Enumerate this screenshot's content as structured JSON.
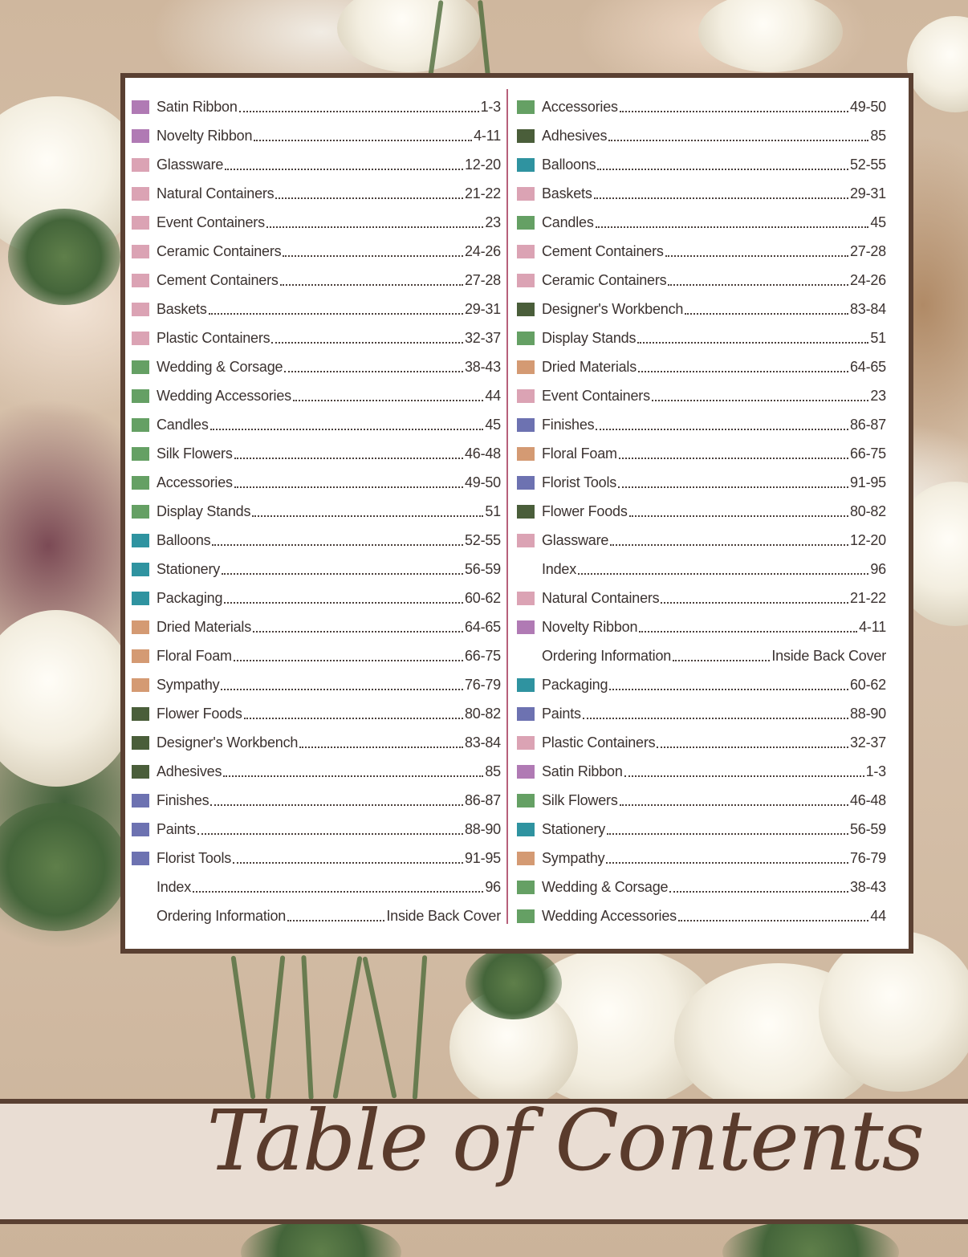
{
  "title": "Table of Contents",
  "colors": {
    "purple": "#b07ab4",
    "pink": "#dba3b4",
    "green": "#65a064",
    "darkgreen": "#4a5e3a",
    "teal": "#2f93a0",
    "tan": "#d49a73",
    "blue": "#6d72b1",
    "frame": "#5a4032",
    "divider": "#b7607a"
  },
  "left_column": [
    {
      "label": "Satin Ribbon",
      "pages": "1-3",
      "color": "purple"
    },
    {
      "label": "Novelty Ribbon",
      "pages": "4-11",
      "color": "purple"
    },
    {
      "label": "Glassware",
      "pages": "12-20",
      "color": "pink"
    },
    {
      "label": "Natural Containers",
      "pages": "21-22",
      "color": "pink"
    },
    {
      "label": "Event Containers",
      "pages": "23",
      "color": "pink"
    },
    {
      "label": "Ceramic Containers",
      "pages": "24-26",
      "color": "pink"
    },
    {
      "label": "Cement Containers",
      "pages": "27-28",
      "color": "pink"
    },
    {
      "label": "Baskets",
      "pages": "29-31",
      "color": "pink"
    },
    {
      "label": "Plastic Containers",
      "pages": "32-37",
      "color": "pink"
    },
    {
      "label": "Wedding & Corsage",
      "pages": "38-43",
      "color": "green"
    },
    {
      "label": "Wedding Accessories",
      "pages": "44",
      "color": "green"
    },
    {
      "label": "Candles",
      "pages": "45",
      "color": "green"
    },
    {
      "label": "Silk Flowers",
      "pages": "46-48",
      "color": "green"
    },
    {
      "label": "Accessories",
      "pages": "49-50",
      "color": "green"
    },
    {
      "label": "Display Stands",
      "pages": "51",
      "color": "green"
    },
    {
      "label": "Balloons",
      "pages": "52-55",
      "color": "teal"
    },
    {
      "label": "Stationery",
      "pages": "56-59",
      "color": "teal"
    },
    {
      "label": "Packaging",
      "pages": "60-62",
      "color": "teal"
    },
    {
      "label": "Dried Materials",
      "pages": "64-65",
      "color": "tan"
    },
    {
      "label": "Floral Foam",
      "pages": "66-75",
      "color": "tan"
    },
    {
      "label": "Sympathy",
      "pages": "76-79",
      "color": "tan"
    },
    {
      "label": "Flower Foods",
      "pages": "80-82",
      "color": "darkgreen"
    },
    {
      "label": "Designer's Workbench",
      "pages": "83-84",
      "color": "darkgreen"
    },
    {
      "label": "Adhesives",
      "pages": "85",
      "color": "darkgreen"
    },
    {
      "label": "Finishes",
      "pages": "86-87",
      "color": "blue"
    },
    {
      "label": "Paints",
      "pages": "88-90",
      "color": "blue"
    },
    {
      "label": "Florist Tools",
      "pages": "91-95",
      "color": "blue"
    },
    {
      "label": "Index",
      "pages": "96",
      "color": "none"
    },
    {
      "label": "Ordering Information",
      "pages": "Inside Back Cover",
      "color": "none"
    }
  ],
  "right_column": [
    {
      "label": "Accessories",
      "pages": "49-50",
      "color": "green"
    },
    {
      "label": "Adhesives",
      "pages": "85",
      "color": "darkgreen"
    },
    {
      "label": "Balloons",
      "pages": "52-55",
      "color": "teal"
    },
    {
      "label": "Baskets",
      "pages": "29-31",
      "color": "pink"
    },
    {
      "label": "Candles",
      "pages": "45",
      "color": "green"
    },
    {
      "label": "Cement Containers",
      "pages": "27-28",
      "color": "pink"
    },
    {
      "label": "Ceramic Containers",
      "pages": "24-26",
      "color": "pink"
    },
    {
      "label": "Designer's Workbench",
      "pages": "83-84",
      "color": "darkgreen"
    },
    {
      "label": "Display Stands",
      "pages": "51",
      "color": "green"
    },
    {
      "label": "Dried Materials",
      "pages": "64-65",
      "color": "tan"
    },
    {
      "label": "Event Containers",
      "pages": "23",
      "color": "pink"
    },
    {
      "label": "Finishes",
      "pages": "86-87",
      "color": "blue"
    },
    {
      "label": "Floral Foam",
      "pages": "66-75",
      "color": "tan"
    },
    {
      "label": "Florist Tools",
      "pages": "91-95",
      "color": "blue"
    },
    {
      "label": "Flower Foods",
      "pages": "80-82",
      "color": "darkgreen"
    },
    {
      "label": "Glassware",
      "pages": "12-20",
      "color": "pink"
    },
    {
      "label": "Index",
      "pages": "96",
      "color": "none"
    },
    {
      "label": "Natural Containers",
      "pages": "21-22",
      "color": "pink"
    },
    {
      "label": "Novelty Ribbon",
      "pages": "4-11",
      "color": "purple"
    },
    {
      "label": "Ordering Information",
      "pages": "Inside Back Cover",
      "color": "none"
    },
    {
      "label": "Packaging",
      "pages": "60-62",
      "color": "teal"
    },
    {
      "label": "Paints",
      "pages": "88-90",
      "color": "blue"
    },
    {
      "label": "Plastic Containers",
      "pages": "32-37",
      "color": "pink"
    },
    {
      "label": "Satin Ribbon",
      "pages": "1-3",
      "color": "purple"
    },
    {
      "label": "Silk Flowers",
      "pages": "46-48",
      "color": "green"
    },
    {
      "label": "Stationery",
      "pages": "56-59",
      "color": "teal"
    },
    {
      "label": "Sympathy",
      "pages": "76-79",
      "color": "tan"
    },
    {
      "label": "Wedding & Corsage",
      "pages": "38-43",
      "color": "green"
    },
    {
      "label": "Wedding Accessories",
      "pages": "44",
      "color": "green"
    }
  ]
}
